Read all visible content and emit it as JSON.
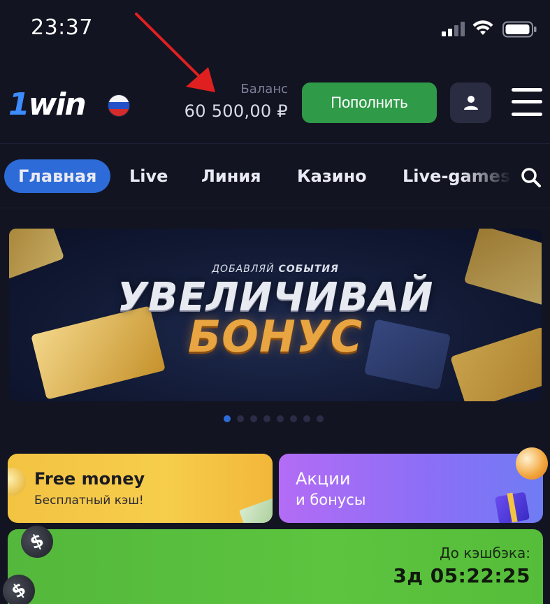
{
  "status_bar": {
    "time": "23:37"
  },
  "header": {
    "logo_text": "1win",
    "balance_label": "Баланс",
    "balance_value": "60 500,00 ₽",
    "deposit_label": "Пополнить"
  },
  "nav": {
    "tabs": [
      {
        "label": "Главная",
        "active": true
      },
      {
        "label": "Live",
        "active": false
      },
      {
        "label": "Линия",
        "active": false
      },
      {
        "label": "Казино",
        "active": false
      },
      {
        "label": "Live-games",
        "active": false
      }
    ]
  },
  "banner": {
    "subtitle_prefix": "ДОБАВЛЯЙ",
    "subtitle_bold": "СОБЫТИЯ",
    "line1": "УВЕЛИЧИВАЙ",
    "line2": "БОНУС",
    "slides_total": 8,
    "active_slide": 1
  },
  "cards": {
    "free_money": {
      "title": "Free money",
      "subtitle": "Бесплатный кэш!"
    },
    "promo": {
      "title": "Акции",
      "subtitle": "и бонусы"
    },
    "cashback": {
      "label": "До кэшбэка:",
      "timer": "3д 05:22:25"
    }
  },
  "colors": {
    "background": "#131421",
    "accent_blue": "#2d6bd8",
    "deposit_green": "#2f9a48",
    "free_money_yellow": "#f3c342",
    "promo_purple": "#b36cf5",
    "cashback_green": "#5cc43f",
    "annotation_arrow": "#e02020"
  }
}
